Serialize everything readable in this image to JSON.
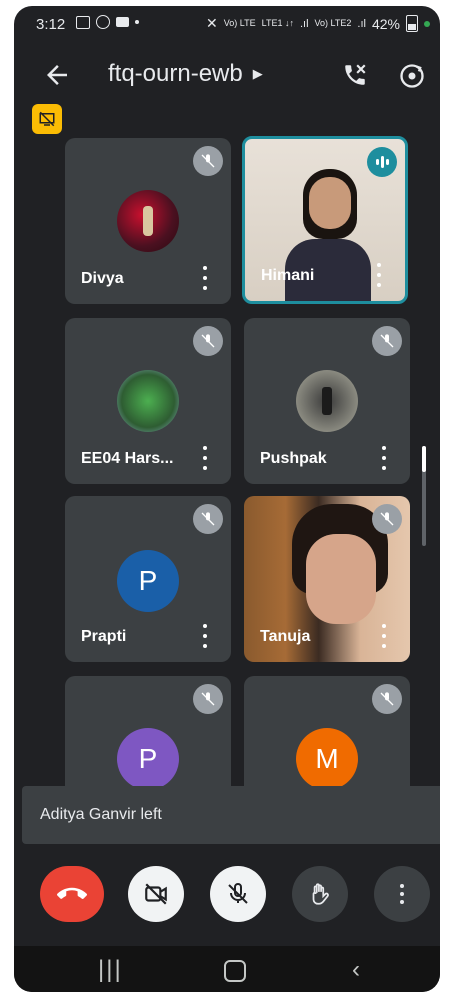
{
  "status_bar": {
    "time": "3:12",
    "signal_labels": [
      "Vo) LTE",
      "LTE1 ↓↑",
      "Vo) LTE2"
    ],
    "battery": "42%"
  },
  "header": {
    "meeting_code": "ftq-ourn-ewb"
  },
  "participants": [
    {
      "name": "Divya",
      "muted": true,
      "avatar": "photo"
    },
    {
      "name": "Himani",
      "muted": false,
      "speaking": true,
      "avatar": "video"
    },
    {
      "name": "EE04 Hars...",
      "muted": true,
      "avatar": "photo"
    },
    {
      "name": "Pushpak",
      "muted": true,
      "avatar": "photo"
    },
    {
      "name": "Prapti",
      "muted": true,
      "avatar_letter": "P",
      "avatar_color": "#1a5fa8"
    },
    {
      "name": "Tanuja",
      "muted": true,
      "avatar": "video"
    },
    {
      "name": "",
      "muted": true,
      "avatar_letter": "P",
      "avatar_color": "#7e57c2"
    },
    {
      "name": "",
      "muted": true,
      "avatar_letter": "M",
      "avatar_color": "#f06b00"
    }
  ],
  "toast": {
    "message": "Aditya Ganvir left"
  },
  "controls": {
    "end_call_color": "#ea4335"
  },
  "colors": {
    "background": "#202124",
    "tile": "#3c4043",
    "active_speaker_border": "#1e8e9e",
    "badge": "#fbbc04"
  }
}
